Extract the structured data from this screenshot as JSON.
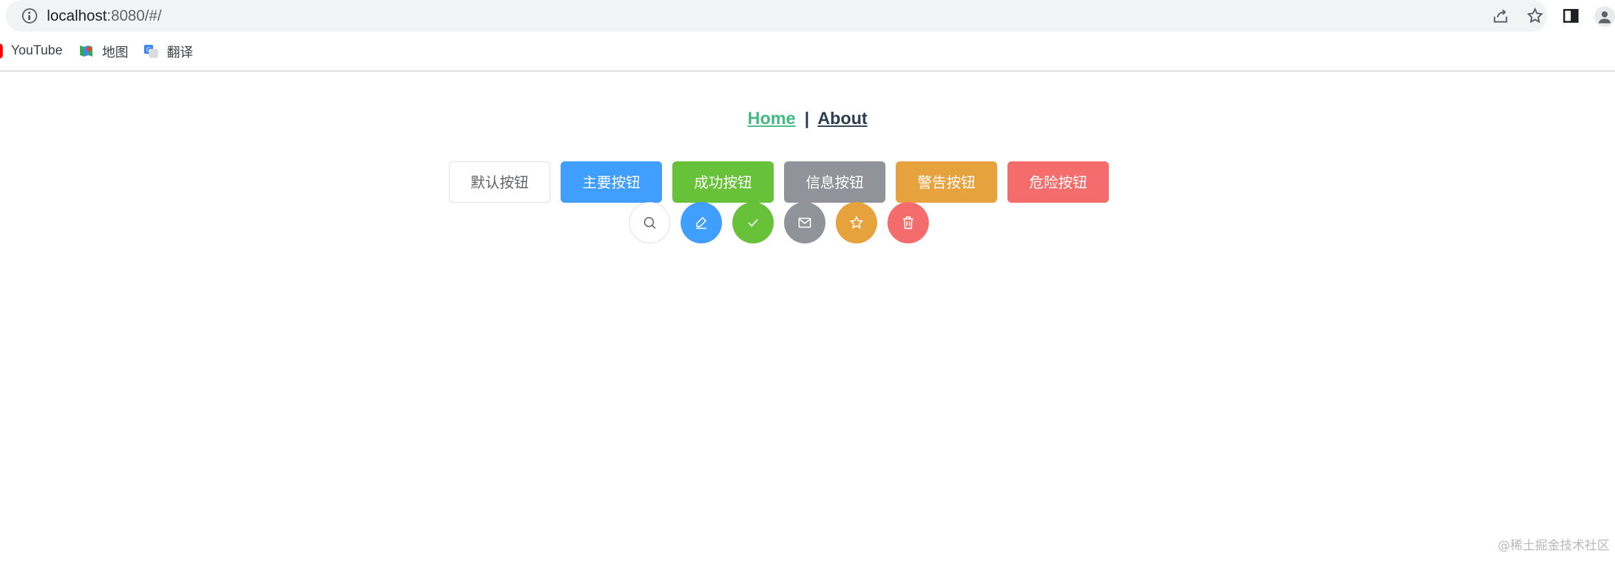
{
  "browser": {
    "url_host": "localhost",
    "url_rest": ":8080/#/",
    "icons": [
      "info-icon",
      "share-icon",
      "star-icon",
      "sidepanel-icon",
      "profile-icon"
    ]
  },
  "bookmarks": [
    {
      "label": "YouTube",
      "icon": "youtube-icon"
    },
    {
      "label": "地图",
      "icon": "maps-icon"
    },
    {
      "label": "翻译",
      "icon": "translate-icon"
    }
  ],
  "nav": {
    "home": "Home",
    "separator": "|",
    "about": "About"
  },
  "buttons": [
    {
      "label": "默认按钮",
      "type": "default"
    },
    {
      "label": "主要按钮",
      "type": "primary"
    },
    {
      "label": "成功按钮",
      "type": "success"
    },
    {
      "label": "信息按钮",
      "type": "info"
    },
    {
      "label": "警告按钮",
      "type": "warning"
    },
    {
      "label": "危险按钮",
      "type": "danger"
    }
  ],
  "circle_buttons": [
    {
      "icon": "search-icon",
      "type": "default"
    },
    {
      "icon": "edit-icon",
      "type": "primary"
    },
    {
      "icon": "check-icon",
      "type": "success"
    },
    {
      "icon": "message-icon",
      "type": "info"
    },
    {
      "icon": "star-icon",
      "type": "warning"
    },
    {
      "icon": "delete-icon",
      "type": "danger"
    }
  ],
  "colors": {
    "primary": "#409eff",
    "success": "#67c23a",
    "info": "#909399",
    "warning": "#e6a23c",
    "danger": "#f56c6c",
    "link_active": "#42b983"
  },
  "watermark": "@稀土掘金技术社区"
}
